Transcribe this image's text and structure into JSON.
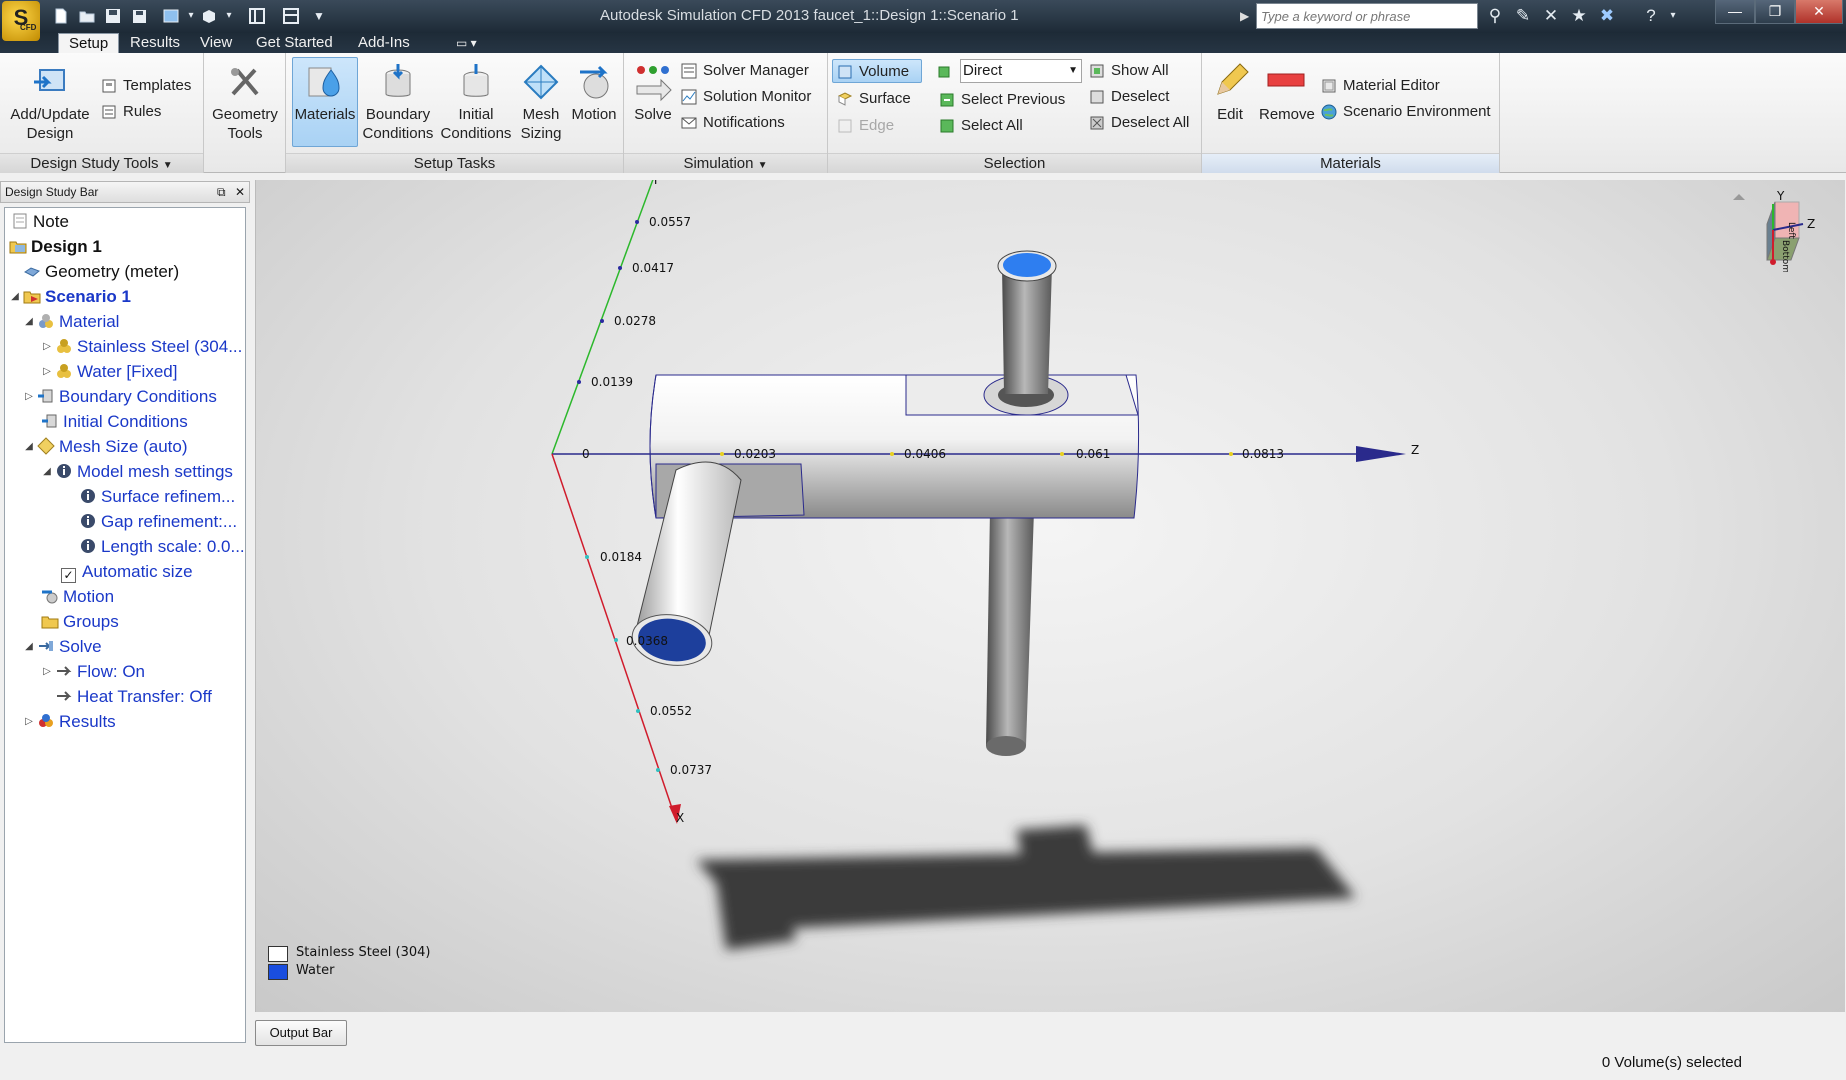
{
  "window": {
    "title": "Autodesk Simulation CFD 2013    faucet_1::Design 1::Scenario 1",
    "logo": "S",
    "logo_sub": "CFD",
    "search_placeholder": "Type a keyword or phrase"
  },
  "ribbon_tabs": [
    "Setup",
    "Results",
    "View",
    "Get Started",
    "Add-Ins"
  ],
  "ribbon": {
    "design_study_tools": {
      "title": "Design Study Tools",
      "add_update": [
        "Add/Update",
        "Design"
      ],
      "templates": "Templates",
      "rules": "Rules"
    },
    "geometry_tools": [
      "Geometry",
      "Tools"
    ],
    "setup_tasks": {
      "title": "Setup Tasks",
      "materials": "Materials",
      "boundary": [
        "Boundary",
        "Conditions"
      ],
      "initial": [
        "Initial",
        "Conditions"
      ],
      "mesh": [
        "Mesh",
        "Sizing"
      ],
      "motion": "Motion"
    },
    "simulation": {
      "title": "Simulation",
      "solve": "Solve",
      "solver_manager": "Solver Manager",
      "solution_monitor": "Solution Monitor",
      "notifications": "Notifications"
    },
    "selection": {
      "title": "Selection",
      "volume": "Volume",
      "surface": "Surface",
      "edge": "Edge",
      "direct": "Direct",
      "select_previous": "Select Previous",
      "select_all": "Select All",
      "show_all": "Show All",
      "deselect": "Deselect",
      "deselect_all": "Deselect All"
    },
    "materials": {
      "title": "Materials",
      "edit": "Edit",
      "remove": "Remove",
      "material_editor": "Material Editor",
      "scenario_environment": "Scenario Environment"
    }
  },
  "design_study_bar": {
    "title": "Design Study Bar",
    "tree": [
      {
        "label": "Note"
      },
      {
        "label": "Design 1"
      },
      {
        "label": "Geometry (meter)"
      },
      {
        "label": "Scenario 1"
      },
      {
        "label": "Material"
      },
      {
        "label": "Stainless Steel (304..."
      },
      {
        "label": "Water [Fixed]"
      },
      {
        "label": "Boundary Conditions"
      },
      {
        "label": "Initial Conditions"
      },
      {
        "label": "Mesh Size (auto)"
      },
      {
        "label": "Model mesh settings"
      },
      {
        "label": "Surface refinem..."
      },
      {
        "label": "Gap refinement:..."
      },
      {
        "label": "Length scale: 0.0..."
      },
      {
        "label": "Automatic size"
      },
      {
        "label": "Motion"
      },
      {
        "label": "Groups"
      },
      {
        "label": "Solve"
      },
      {
        "label": "Flow: On"
      },
      {
        "label": "Heat Transfer: Off"
      },
      {
        "label": "Results"
      }
    ]
  },
  "viewport": {
    "axes": {
      "y_name": "Y",
      "z_name": "Z",
      "x_name": "X",
      "y_ticks": [
        "0.0557",
        "0.0417",
        "0.0278",
        "0.0139"
      ],
      "z_ticks": [
        "0",
        "0.0203",
        "0.0406",
        "0.061",
        "0.0813"
      ],
      "x_ticks": [
        "0.0184",
        "0.0368",
        "0.0552",
        "0.0737"
      ]
    },
    "legend": [
      {
        "label": "Stainless Steel (304)",
        "color": "#ffffff"
      },
      {
        "label": "Water",
        "color": "#1a4ee0"
      }
    ],
    "viewcube": {
      "left_face": "Left",
      "bottom_face": "Bottom",
      "y": "Y",
      "z": "Z"
    }
  },
  "output_bar": "Output Bar",
  "status": "0 Volume(s) selected",
  "colors": {
    "accent": "#a9d2f4",
    "water": "#1a4ee0",
    "x_axis": "#d01c2c",
    "y_axis": "#2cb82c",
    "z_axis": "#2a2a8c"
  }
}
